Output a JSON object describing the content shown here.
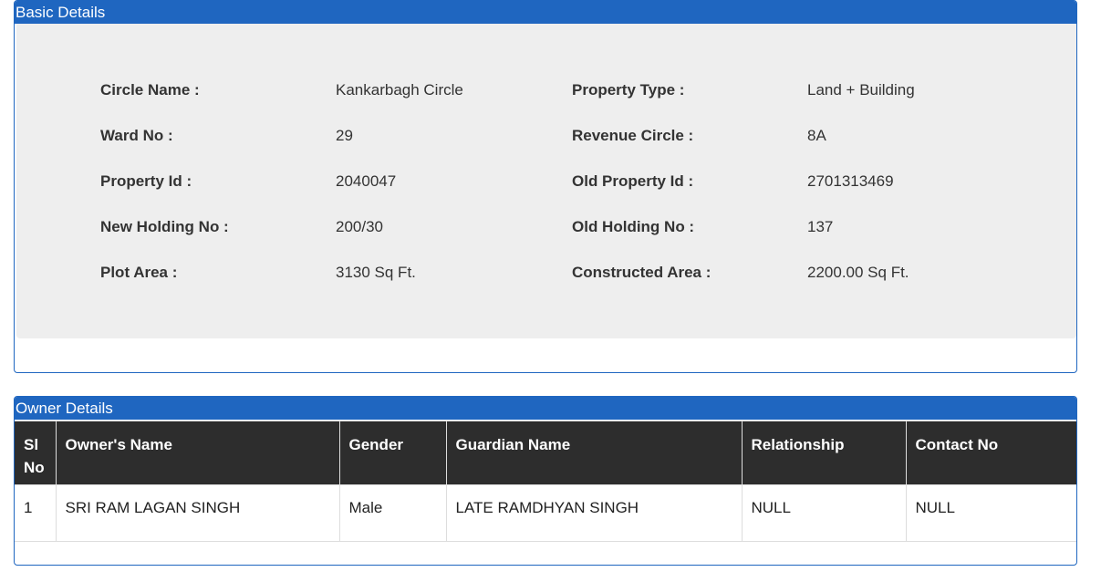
{
  "basic_details": {
    "title": "Basic Details",
    "rows": [
      {
        "l1": "Circle Name :",
        "v1": "Kankarbagh Circle",
        "l2": "Property Type :",
        "v2": "Land + Building"
      },
      {
        "l1": "Ward No :",
        "v1": "29",
        "l2": "Revenue Circle :",
        "v2": "8A"
      },
      {
        "l1": "Property Id :",
        "v1": "2040047",
        "l2": "Old Property Id :",
        "v2": "2701313469"
      },
      {
        "l1": "New Holding No :",
        "v1": "200/30",
        "l2": "Old Holding No :",
        "v2": "137"
      },
      {
        "l1": "Plot Area :",
        "v1": "3130 Sq Ft.",
        "l2": "Constructed Area :",
        "v2": "2200.00 Sq Ft."
      }
    ]
  },
  "owner_details": {
    "title": "Owner Details",
    "columns": [
      "Sl No",
      "Owner's Name",
      "Gender",
      "Guardian Name",
      "Relationship",
      "Contact No"
    ],
    "rows": [
      [
        "1",
        "SRI RAM LAGAN SINGH",
        "Male",
        "LATE RAMDHYAN SINGH",
        "NULL",
        "NULL"
      ]
    ]
  },
  "colors": {
    "panel_header": "#1f66c0",
    "table_header": "#2d2d2d",
    "well_background": "#eeeeee"
  }
}
